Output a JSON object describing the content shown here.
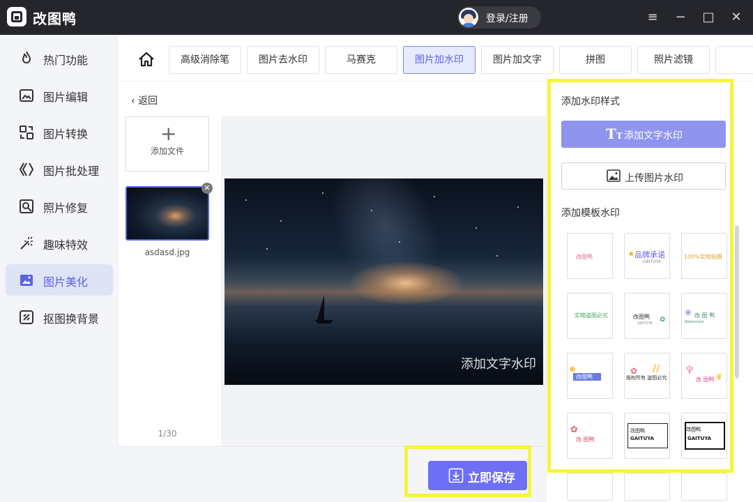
{
  "app": {
    "title": "改图鸭",
    "login_label": "登录/注册"
  },
  "window_controls": [
    "≡",
    "−",
    "□",
    "✕"
  ],
  "sidebar": {
    "items": [
      {
        "label": "热门功能",
        "icon": "fire-icon"
      },
      {
        "label": "图片编辑",
        "icon": "image-edit-icon"
      },
      {
        "label": "图片转换",
        "icon": "convert-icon"
      },
      {
        "label": "图片批处理",
        "icon": "batch-icon"
      },
      {
        "label": "照片修复",
        "icon": "repair-icon"
      },
      {
        "label": "趣味特效",
        "icon": "magic-wand-icon"
      },
      {
        "label": "图片美化",
        "icon": "beautify-icon",
        "active": true
      },
      {
        "label": "抠图换背景",
        "icon": "cutout-icon"
      }
    ]
  },
  "tabs": [
    "高级消除笔",
    "图片去水印",
    "马赛克",
    "图片加水印",
    "图片加文字",
    "拼图",
    "照片滤镜"
  ],
  "active_tab": "图片加水印",
  "editor": {
    "back_label": "返回",
    "add_file_label": "添加文件",
    "file_name": "asdasd.jpg",
    "page_current": "1",
    "page_total": "/30",
    "watermark_preview_text": "添加文字水印",
    "save_label": "立即保存"
  },
  "panel": {
    "style_title": "添加水印样式",
    "add_text_label": "添加文字水印",
    "upload_image_label": "上传图片水印",
    "template_title": "添加模板水印",
    "templates": [
      {
        "a": "改图鸭",
        "b": ""
      },
      {
        "a": "品牌承诺",
        "b": "GAITUYA"
      },
      {
        "a": "100%实物拍摄",
        "b": ""
      },
      {
        "a": "实物盗图必究",
        "b": ""
      },
      {
        "a": "改图鸭",
        "b": "GAITUYA"
      },
      {
        "a": "改 图 鸭",
        "b": "Watermark"
      },
      {
        "a": "改图鸭",
        "b": ""
      },
      {
        "a": "版权所有 盗图必究",
        "b": ""
      },
      {
        "a": "改 图鸭",
        "b": ""
      },
      {
        "a": "改 图鸭",
        "b": ""
      },
      {
        "a": "改图鸭",
        "b": "GAITUYA"
      },
      {
        "a": "改图鸭",
        "b": "GAITUYA"
      }
    ]
  },
  "colors": {
    "accent": "#6f6ff5",
    "highlight": "#f5f53a",
    "titlebar": "#25262b"
  }
}
